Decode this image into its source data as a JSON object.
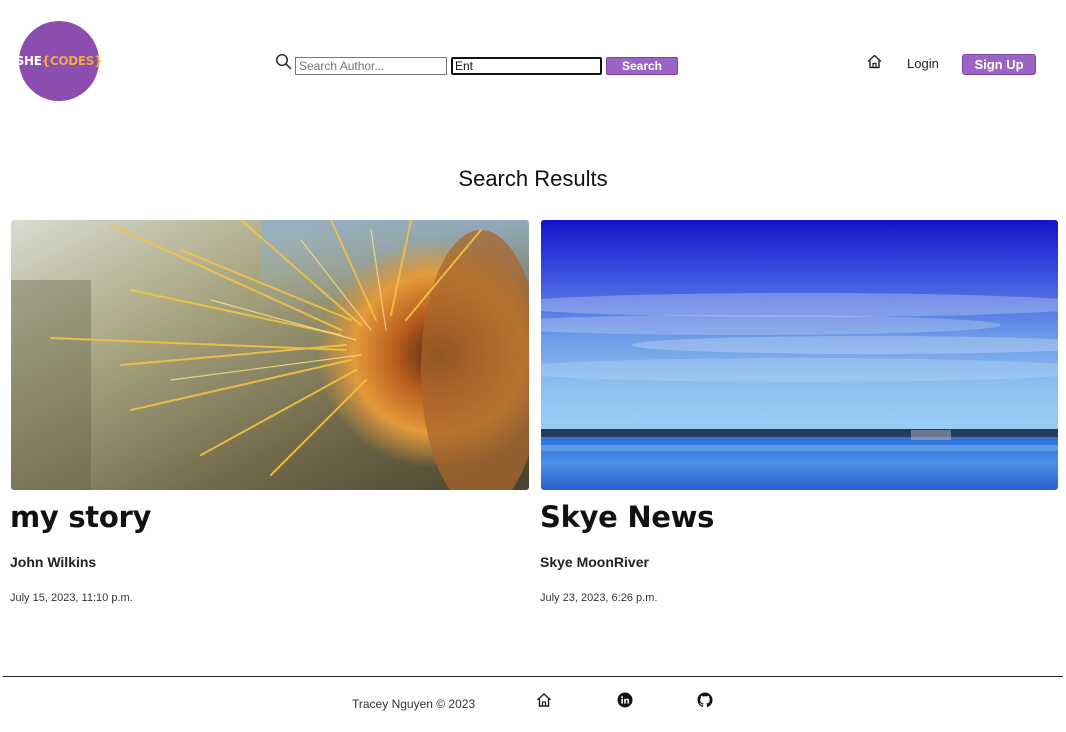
{
  "header": {
    "logo": {
      "she": "SHE",
      "codes": "{CODES}"
    },
    "search_author_placeholder": "Search Author...",
    "search_title_value": "Ent",
    "search_button": "Search",
    "nav": {
      "login": "Login",
      "signup": "Sign Up"
    }
  },
  "page_title": "Search Results",
  "results": [
    {
      "title": "my story",
      "author": "John Wilkins",
      "date": "July 15, 2023, 11:10 p.m."
    },
    {
      "title": "Skye News",
      "author": "Skye MoonRiver",
      "date": "July 23, 2023, 6:26 p.m."
    }
  ],
  "footer": {
    "credit": "Tracey Nguyen  © 2023"
  },
  "icons": [
    "search-icon",
    "home-icon",
    "linkedin-icon",
    "github-icon"
  ],
  "colors": {
    "brand_purple": "#8b4db0",
    "button_purple": "#9b63c3",
    "logo_orange": "#f2a93b"
  }
}
